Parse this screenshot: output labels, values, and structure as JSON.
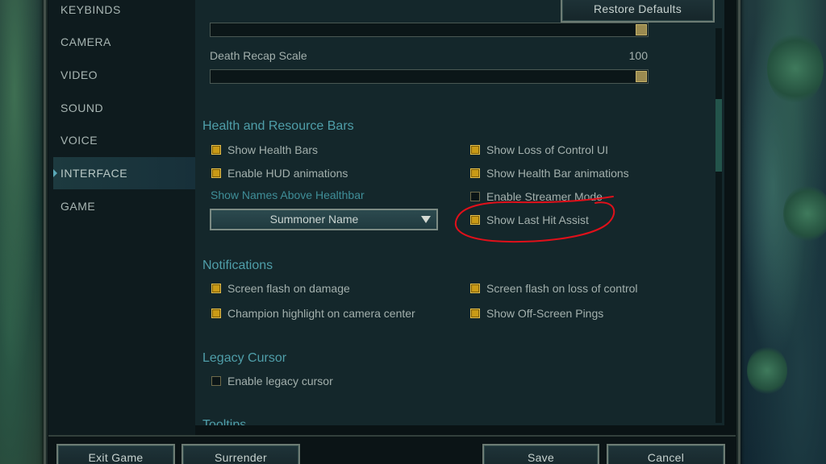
{
  "sidebar": {
    "items": [
      {
        "label": "KEYBINDS"
      },
      {
        "label": "CAMERA"
      },
      {
        "label": "VIDEO"
      },
      {
        "label": "SOUND"
      },
      {
        "label": "VOICE"
      },
      {
        "label": "INTERFACE",
        "active": true
      },
      {
        "label": "GAME"
      }
    ]
  },
  "header": {
    "restore_defaults_label": "Restore Defaults"
  },
  "sliders": {
    "partial": {
      "value": 1.0
    },
    "death_recap": {
      "label": "Death Recap Scale",
      "value_text": "100",
      "value": 1.0
    }
  },
  "health_bars": {
    "title": "Health and Resource Bars",
    "show_health_bars": {
      "label": "Show Health Bars",
      "checked": true
    },
    "enable_hud_animations": {
      "label": "Enable HUD animations",
      "checked": true
    },
    "show_names_heading": "Show Names Above Healthbar",
    "names_dropdown": {
      "value": "Summoner Name"
    },
    "show_loss_of_control": {
      "label": "Show Loss of Control UI",
      "checked": true
    },
    "show_health_bar_animations": {
      "label": "Show Health Bar animations",
      "checked": true
    },
    "enable_streamer_mode": {
      "label": "Enable Streamer Mode",
      "checked": false
    },
    "show_last_hit_assist": {
      "label": "Show Last Hit Assist",
      "checked": true
    }
  },
  "notifications": {
    "title": "Notifications",
    "screen_flash_damage": {
      "label": "Screen flash on damage",
      "checked": true
    },
    "champion_highlight": {
      "label": "Champion highlight on camera center",
      "checked": true
    },
    "screen_flash_loss_control": {
      "label": "Screen flash on loss of control",
      "checked": true
    },
    "show_offscreen_pings": {
      "label": "Show Off-Screen Pings",
      "checked": true
    }
  },
  "legacy_cursor": {
    "title": "Legacy Cursor",
    "enable_legacy_cursor": {
      "label": "Enable legacy cursor",
      "checked": false
    }
  },
  "next_section_title": "Tooltips",
  "footer": {
    "exit_game_label": "Exit Game",
    "surrender_label": "Surrender",
    "save_label": "Save",
    "cancel_label": "Cancel"
  },
  "colors": {
    "accent_teal": "#4f9ea9",
    "checkbox_gold": "#c99a16",
    "annotation_red": "#e0101a"
  }
}
